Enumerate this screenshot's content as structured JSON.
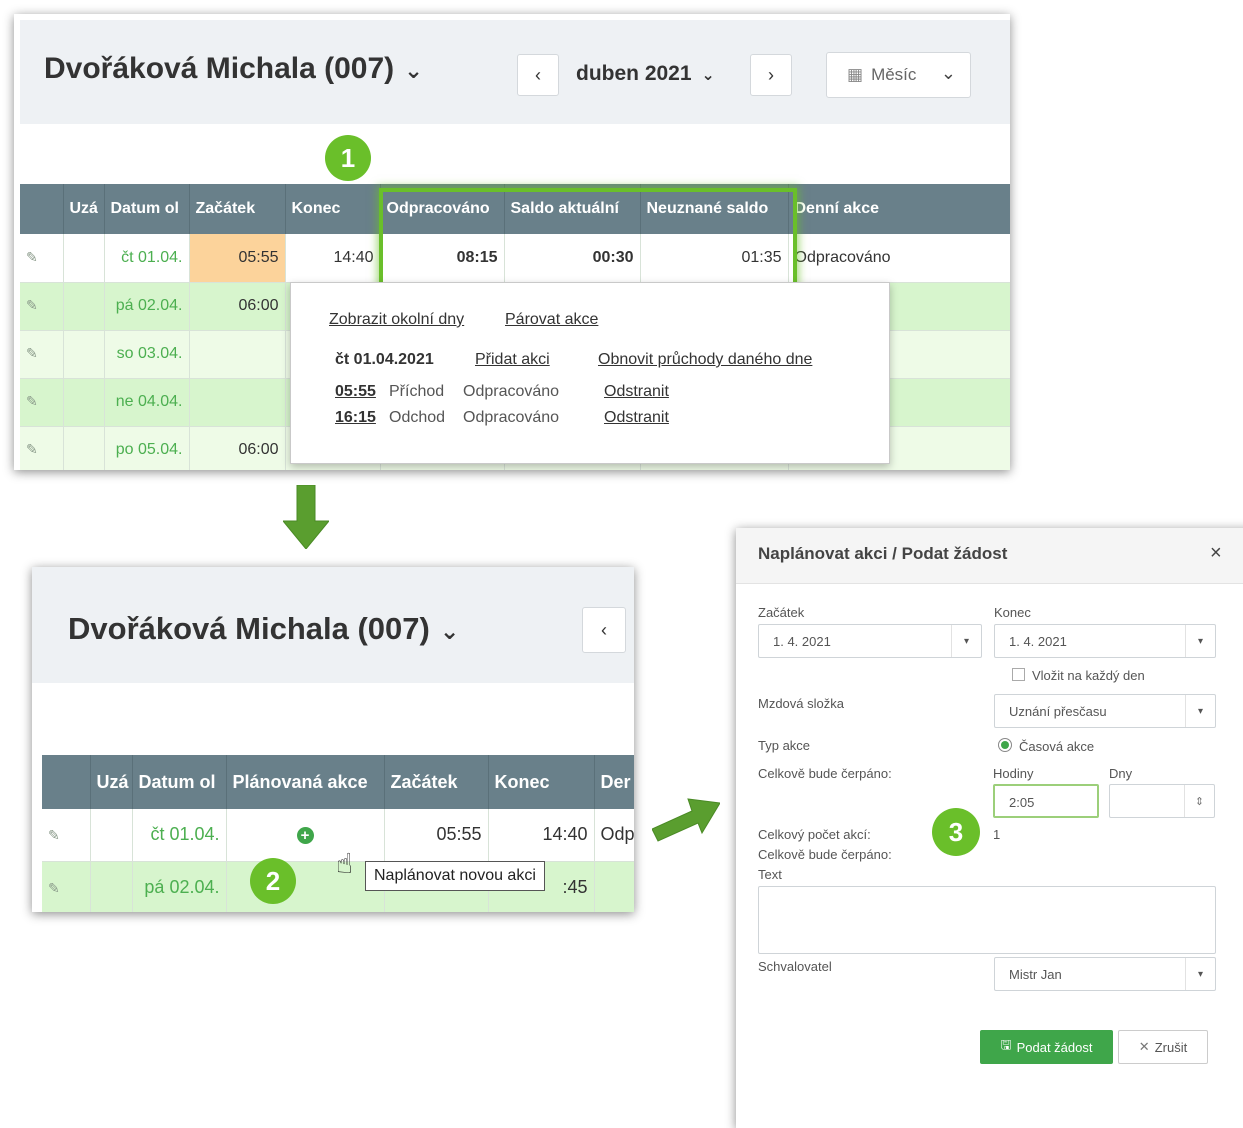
{
  "employee": {
    "name": "Dvořáková Michala (007)",
    "chevron": "⌄"
  },
  "nav": {
    "prev": "‹",
    "next": "›",
    "month": "duben 2021",
    "month_chevron": "⌄",
    "view": "Měsíc",
    "view_chevron": "⌄",
    "calendar_icon": "▦"
  },
  "markers": [
    "1",
    "2",
    "3"
  ],
  "table1": {
    "headers": [
      "",
      "Uzá",
      "Datum ol",
      "Začátek",
      "Konec",
      "Odpracováno",
      "Saldo aktuální",
      "Neuznané saldo",
      "Denní akce"
    ],
    "rows": [
      {
        "date": "čt 01.04.",
        "start": "05:55",
        "end": "14:40",
        "worked": "08:15",
        "saldo": "00:30",
        "unrecognized": "01:35",
        "action": "Odpracováno"
      },
      {
        "date": "pá 02.04.",
        "start": "06:00",
        "end": "",
        "worked": "",
        "saldo": "",
        "unrecognized": "",
        "action": ""
      },
      {
        "date": "so 03.04.",
        "start": "",
        "end": "",
        "worked": "",
        "saldo": "",
        "unrecognized": "",
        "action": ""
      },
      {
        "date": "ne 04.04.",
        "start": "",
        "end": "",
        "worked": "",
        "saldo": "",
        "unrecognized": "",
        "action": ""
      },
      {
        "date": "po 05.04.",
        "start": "06:00",
        "end": "",
        "worked": "",
        "saldo": "",
        "unrecognized": "",
        "action": ""
      }
    ]
  },
  "popup": {
    "show_surrounding": "Zobrazit okolní dny",
    "pair_actions": "Párovat akce",
    "day": "čt 01.04.2021",
    "add_action": "Přidat akci",
    "refresh_passes": "Obnovit průchody daného dne",
    "entries": [
      {
        "time": "05:55",
        "type": "Příchod",
        "category": "Odpracováno",
        "remove": "Odstranit"
      },
      {
        "time": "16:15",
        "type": "Odchod",
        "category": "Odpracováno",
        "remove": "Odstranit"
      }
    ]
  },
  "table2": {
    "headers": [
      "",
      "Uzá",
      "Datum ol",
      "Plánovaná akce",
      "Začátek",
      "Konec",
      "Der"
    ],
    "rows": [
      {
        "date": "čt 01.04.",
        "start": "05:55",
        "end": "14:40",
        "action": "Odp"
      },
      {
        "date": "pá 02.04.",
        "start": "",
        "end": ":45",
        "action": ""
      }
    ]
  },
  "tooltip": "Naplánovat novou akci",
  "modal": {
    "title": "Naplánovat akci / Podat žádost",
    "close": "×",
    "start_label": "Začátek",
    "start_value": "1. 4. 2021",
    "end_label": "Konec",
    "end_value": "1. 4. 2021",
    "every_day": "Vložit na každý den",
    "wage_label": "Mzdová složka",
    "wage_value": "Uznání přesčasu",
    "type_label": "Typ akce",
    "type_value": "Časová akce",
    "total_label": "Celkově bude čerpáno:",
    "hours_label": "Hodiny",
    "hours_value": "2:05",
    "days_label": "Dny",
    "count_label": "Celkový počet akcí:",
    "count_value": "1",
    "total_label2": "Celkově bude čerpáno:",
    "text_label": "Text",
    "approver_label": "Schvalovatel",
    "approver_value": "Mistr Jan",
    "submit": "Podat žádost",
    "cancel": "Zrušit",
    "dropdown_icon": "▾",
    "stepper_icon": "⇕",
    "save_icon": "🖫",
    "cancel_icon": "✕"
  },
  "colors": {
    "accent": "#6abf2a",
    "header_bg": "#69808a",
    "date": "#4caf50",
    "button": "#3fa64a"
  }
}
